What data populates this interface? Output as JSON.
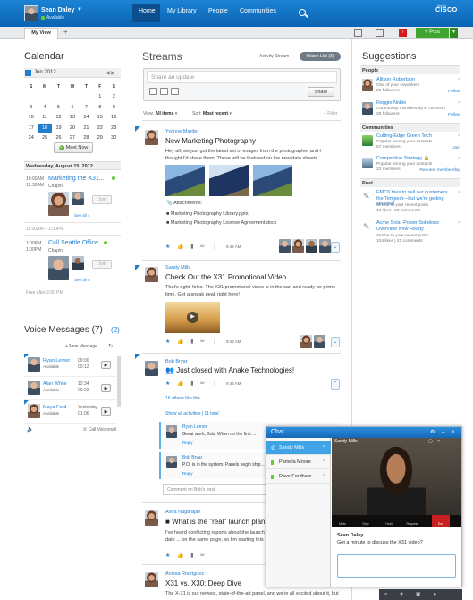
{
  "header": {
    "user_name": "Sean Daley",
    "user_status": "Available",
    "nav": [
      "Home",
      "My Library",
      "People",
      "Communities"
    ],
    "brand": "CISCO"
  },
  "tabs": {
    "my_view": "My View",
    "add": "+"
  },
  "toolbar": {
    "notifications_count": "7",
    "post_label": "+ Post"
  },
  "calendar": {
    "title": "Calendar",
    "month": "Jun 2012",
    "dow": [
      "S",
      "M",
      "T",
      "W",
      "T",
      "F",
      "S"
    ],
    "weeks": [
      [
        "",
        "",
        "",
        "",
        "",
        "1",
        "2"
      ],
      [
        "3",
        "4",
        "5",
        "6",
        "7",
        "8",
        "9"
      ],
      [
        "10",
        "11",
        "12",
        "13",
        "14",
        "15",
        "16"
      ],
      [
        "17",
        "18",
        "19",
        "20",
        "21",
        "22",
        "23"
      ],
      [
        "24",
        "25",
        "26",
        "27",
        "28",
        "29",
        "30"
      ]
    ],
    "today": "18",
    "meet_now": "Meet Now",
    "date_header": "Wednesday, August 15, 2012",
    "events": [
      {
        "time1": "10:00AM",
        "time2": "12:30AM",
        "title": "Marketing the X31...",
        "location": "Chapin",
        "see_all": "See all 4",
        "join": "Join"
      },
      {
        "time1": "1:00PM",
        "time2": "1:00PM",
        "title": "Call Seattle Office...",
        "location": "Chapin",
        "see_all": "See all 5",
        "join": "Join"
      }
    ],
    "free_1": "11:00AM – 1:00PM",
    "free_2": "Free after 2:00 PM"
  },
  "voice": {
    "title": "Voice Messages (7)",
    "badge": "(2)",
    "new_message": "+ New Message",
    "messages": [
      {
        "name": "Ryan Lerner",
        "status": "Available",
        "time": "09:00",
        "dur": "00:12"
      },
      {
        "name": "Alan White",
        "status": "Available",
        "time": "12:34",
        "dur": "00:22"
      },
      {
        "name": "Maya Ford",
        "status": "Available",
        "time": "Yesterday",
        "dur": "01:06"
      }
    ],
    "call_voicemail": "Call Voicemail"
  },
  "streams": {
    "title": "Streams",
    "activity_stream": "Activity Stream",
    "watch_list": "Watch List (3)",
    "share_placeholder": "Share an update",
    "share_btn": "Share",
    "view_label": "View:",
    "view_value": "All items",
    "sort_label": "Sort:",
    "sort_value": "Most recent",
    "filter": "+ Filter",
    "posts": [
      {
        "author": "Yvonne Marder",
        "title": "New Marketing Photography",
        "text": "Hey all, we just got the latest set of images from the photographer and I thought I'd share them. These will be featured on the new data sheets ...",
        "attachments_label": "Attachments:",
        "attach1": "Marketing Photography Library.pptx",
        "attach2": "Marketing Photography License Agreement.docx",
        "time": "9:42 AM"
      },
      {
        "author": "Sandy Mills",
        "title": "Check Out the X31 Promotional Video",
        "text": "That's right, folks. The X31 promotional video is in the can and ready for prime time. Get a sneak peak right here!",
        "time": "9:42 AM"
      },
      {
        "author": "Bob Bryar",
        "title": "Just closed with Anake Technologies!",
        "time": "9:42 AM",
        "likes": "16 others like this",
        "show_all": "Show all activities | 11 total",
        "replies": [
          {
            "author": "Ryan Lerner",
            "text": "Great work, Bob. When do the first ...",
            "reply": "Reply"
          },
          {
            "author": "Bob Bryar",
            "text": "P.O. is in the system. Panels begin ship...",
            "reply": "Reply"
          }
        ],
        "comment_placeholder": "Comment on Bob's post"
      },
      {
        "author": "Asha Nagarajan",
        "title": "What is the \"real\" launch plan",
        "text": "I've heard conflicting reports about the launch date ... on the same page, so I'm starting this Q&A ..."
      },
      {
        "author": "Anissa Rodriguez",
        "title": "X31 vs. X30: Deep Dive",
        "text": "The X-31 is our newest, state-of-the-art panel, and we're all excited about it, but"
      }
    ]
  },
  "suggestions": {
    "title": "Suggestions",
    "people_label": "People",
    "people": [
      {
        "name": "Allison Robertson",
        "sub1": "One of your coworkers",
        "sub2": "26 followers",
        "action": "Follow"
      },
      {
        "name": "Reggie Noble",
        "sub1": "Community membership in common",
        "sub2": "28 followers",
        "action": "Follow"
      }
    ],
    "communities_label": "Communities",
    "communities": [
      {
        "name": "Cutting-Edge Green Tech",
        "sub1": "Popular among your contacts",
        "sub2": "67 members",
        "action": "Join"
      },
      {
        "name": "Competitive Strategy",
        "sub1": "Popular among your contacts",
        "sub2": "22 members",
        "action": "Request membership"
      }
    ],
    "post_label": "Post",
    "posts": [
      {
        "name": "EMC6 tries to sell our customers the Tempest—but we're getting smarter!",
        "sub1": "Similar to your recent posts",
        "sub2": "16 likes | 20 comments"
      },
      {
        "name": "Acme Solar-Power Solutions Overview Now Ready",
        "sub1": "Similar to your recent posts",
        "sub2": "104 likes | 21 comments"
      }
    ]
  },
  "chat": {
    "title": "Chat",
    "contacts": [
      "Sandy Mills",
      "Pamela Moore",
      "Dave Fordham"
    ],
    "active": "Sandy Mills",
    "video_controls": [
      "Mute",
      "Stop Video",
      "Hold",
      "Request",
      "End"
    ],
    "from": "Sean Daley",
    "message": "Got a minute to discuss the X31 video?"
  }
}
